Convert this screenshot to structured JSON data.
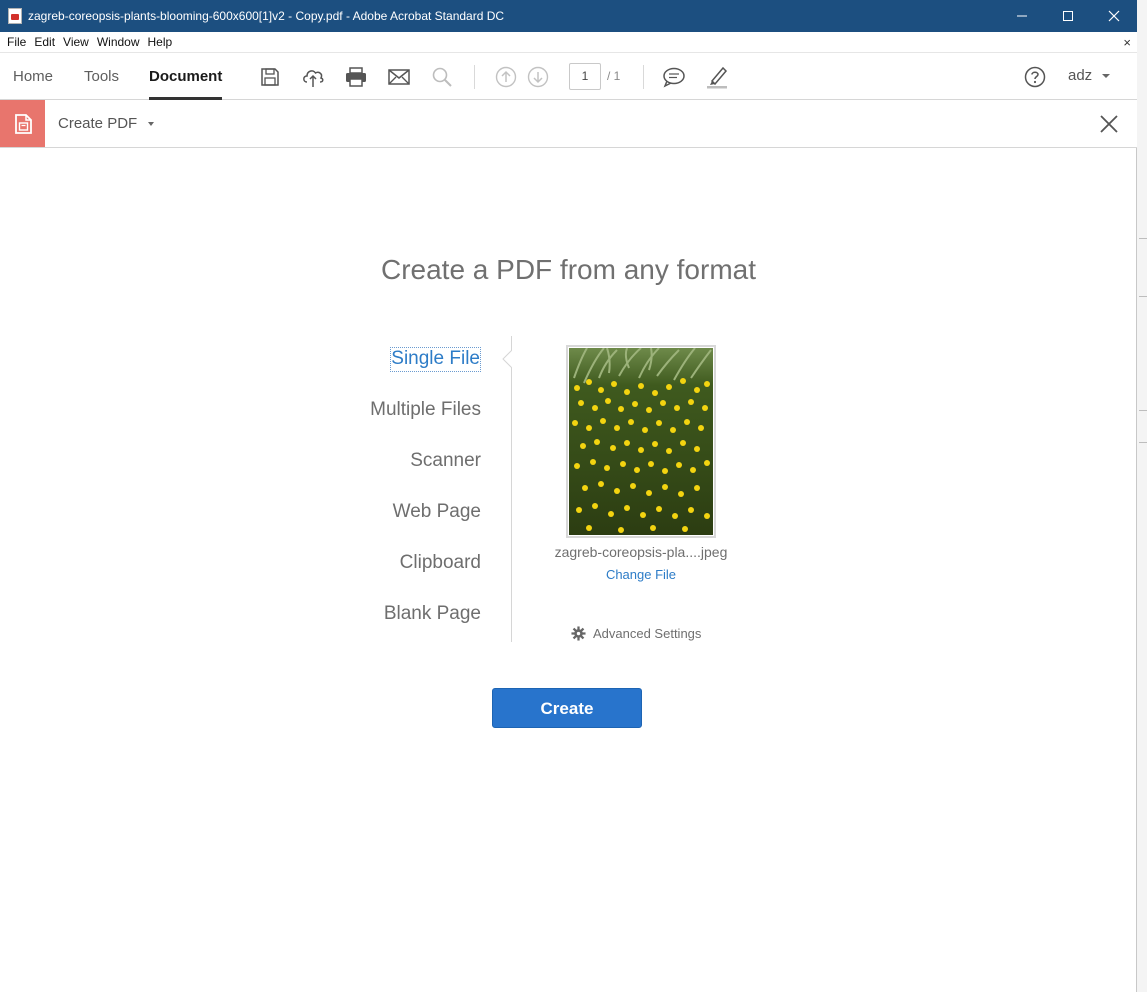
{
  "window": {
    "title": "zagreb-coreopsis-plants-blooming-600x600[1]v2 - Copy.pdf - Adobe Acrobat Standard DC",
    "controls": [
      "minimize-icon",
      "maximize-icon",
      "close-icon"
    ]
  },
  "menu": {
    "items": [
      "File",
      "Edit",
      "View",
      "Window",
      "Help"
    ],
    "close_doc": "×"
  },
  "toolbar": {
    "tabs": [
      "Home",
      "Tools",
      "Document"
    ],
    "active_tab": "Document",
    "page_current": "1",
    "page_total": "/ 1",
    "user": "adz",
    "icons": [
      "save-icon",
      "cloud-upload-icon",
      "print-icon",
      "email-icon",
      "search-icon",
      "prev-page-icon",
      "next-page-icon",
      "comment-icon",
      "highlight-pen-icon",
      "help-icon"
    ]
  },
  "tool_header": {
    "name": "Create PDF",
    "icon": "create-pdf-icon"
  },
  "main": {
    "headline": "Create a PDF from any format",
    "options": [
      "Single File",
      "Multiple Files",
      "Scanner",
      "Web Page",
      "Clipboard",
      "Blank Page"
    ],
    "selected_option": "Single File",
    "file_name": "zagreb-coreopsis-pla....jpeg",
    "change_file": "Change File",
    "advanced_settings": "Advanced Settings",
    "create_button": "Create"
  },
  "colors": {
    "titlebar": "#1c4f80",
    "accent_blue": "#2d7cc7",
    "create_button": "#2874cc",
    "tool_icon_bg": "#e8756d"
  }
}
